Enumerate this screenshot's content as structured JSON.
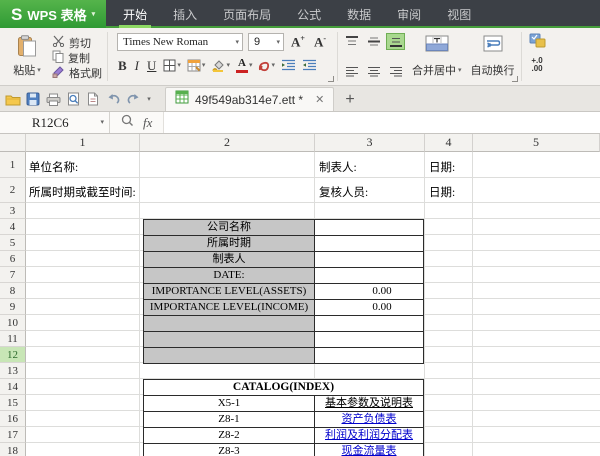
{
  "titlebar": {
    "logo_s": "S",
    "logo_text": "WPS 表格",
    "tabs": [
      "开始",
      "插入",
      "页面布局",
      "公式",
      "数据",
      "审阅",
      "视图"
    ],
    "active_tab": "开始"
  },
  "icons": {
    "caret_down": "▾",
    "close": "✕",
    "new_tab": "+",
    "fx": "fx",
    "font_letter": "A",
    "grow_suffix": "+",
    "shrink_suffix": "-"
  },
  "ribbon": {
    "paste": "粘贴",
    "cut": "剪切",
    "copy": "复制",
    "format_painter": "格式刷",
    "font_family": "Times New Roman",
    "font_size": "9",
    "bold": "B",
    "italic": "I",
    "underline": "U",
    "merge_center": "合并居中",
    "wrap_text": "自动换行",
    "num_inc": "+.0",
    "num_dec": ".00"
  },
  "doc_tab": {
    "title": "49f549ab314e7.ett *"
  },
  "formula_bar": {
    "name_box": "R12C6",
    "value": ""
  },
  "sheet": {
    "col_headers": [
      "1",
      "2",
      "3",
      "4",
      "5"
    ],
    "row_headers": [
      "1",
      "2",
      "3",
      "4",
      "5",
      "6",
      "7",
      "8",
      "9",
      "10",
      "11",
      "12",
      "13",
      "14",
      "15",
      "16",
      "17",
      "18"
    ],
    "selected_row": "12",
    "selected_cell": "R12C6",
    "cells": {
      "r1c1": "单位名称:",
      "r1c3": "制表人:",
      "r1c4": "日期:",
      "r2c1": "所属时期或截至时间:",
      "r2c3": "复核人员:",
      "r2c4": "日期:"
    },
    "info_table": {
      "rows": [
        {
          "label": "公司名称",
          "value": ""
        },
        {
          "label": "所属时期",
          "value": ""
        },
        {
          "label": "制表人",
          "value": ""
        },
        {
          "label": "DATE:",
          "value": ""
        },
        {
          "label": "IMPORTANCE LEVEL(ASSETS)",
          "value": "0.00"
        },
        {
          "label": "IMPORTANCE LEVEL(INCOME)",
          "value": "0.00"
        },
        {
          "label": "",
          "value": ""
        },
        {
          "label": "",
          "value": ""
        },
        {
          "label": "",
          "value": ""
        }
      ]
    },
    "catalog": {
      "title": "CATALOG(INDEX)",
      "rows": [
        {
          "code": "X5-1",
          "name": "基本参数及说明表",
          "link": false
        },
        {
          "code": "Z8-1",
          "name": "资产负债表",
          "link": true
        },
        {
          "code": "Z8-2",
          "name": "利润及利润分配表",
          "link": true
        },
        {
          "code": "Z8-3",
          "name": "现金流量表",
          "link": true
        }
      ]
    }
  },
  "colors": {
    "wps_green": "#43a33d",
    "tab_underline": "#8ed964",
    "link_blue": "#0000cc",
    "cell_gray": "#c6c6c6",
    "row_highlight": "#c8e6b6"
  }
}
